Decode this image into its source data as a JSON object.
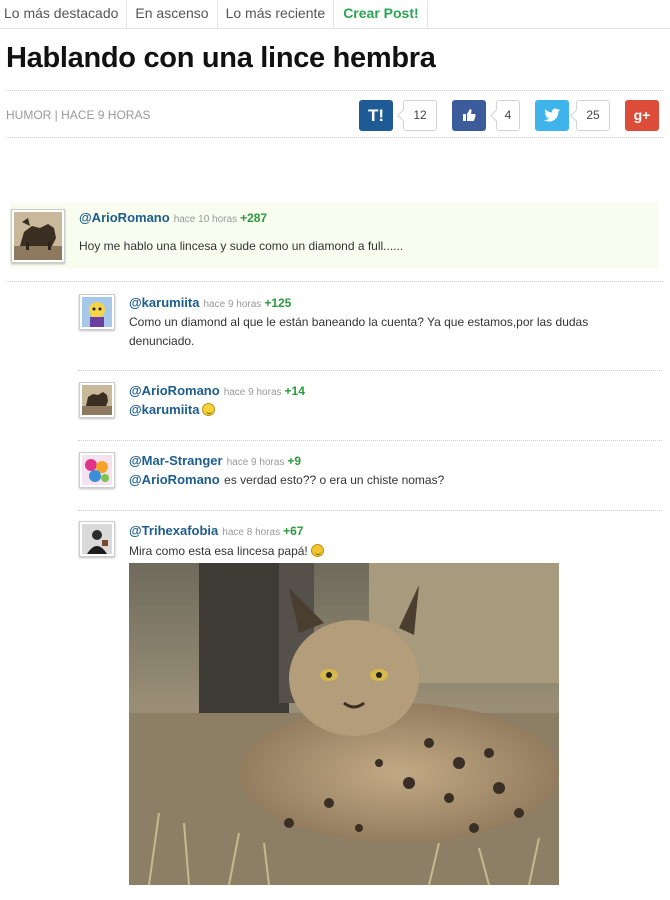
{
  "nav": {
    "tabs": [
      "Lo más destacado",
      "En ascenso",
      "Lo más reciente"
    ],
    "create_label": "Crear Post!"
  },
  "post": {
    "title": "Hablando con una lince hembra",
    "meta": "HUMOR | HACE 9 HORAS",
    "share": {
      "taringa": {
        "label": "T!",
        "count": "12"
      },
      "facebook": {
        "icon": "thumbs-up-icon",
        "count": "4"
      },
      "twitter": {
        "icon": "bird-icon",
        "count": "25"
      },
      "googleplus": {
        "label": "g+"
      }
    }
  },
  "comments": [
    {
      "user": "@ArioRomano",
      "time": "hace 10 horas",
      "score": "+287",
      "text": "Hoy me hablo una lincesa y sude como un diamond a full......"
    },
    {
      "user": "@karumiita",
      "time": "hace 9 horas",
      "score": "+125",
      "text": "Como un diamond al que le están baneando la cuenta? Ya que estamos,por las dudas denunciado."
    },
    {
      "user": "@ArioRomano",
      "time": "hace 9 horas",
      "score": "+14",
      "mention": "@karumiita"
    },
    {
      "user": "@Mar-Stranger",
      "time": "hace 9 horas",
      "score": "+9",
      "mention": "@ArioRomano",
      "text": "es verdad esto?? o era un chiste nomas?"
    },
    {
      "user": "@Trihexafobia",
      "time": "hace 8 horas",
      "score": "+67",
      "text": "Mira como esta esa lincesa papá!"
    }
  ],
  "colors": {
    "accent_green": "#2aa552",
    "user_blue": "#1d5d8d",
    "score_green": "#2a9a3c"
  }
}
